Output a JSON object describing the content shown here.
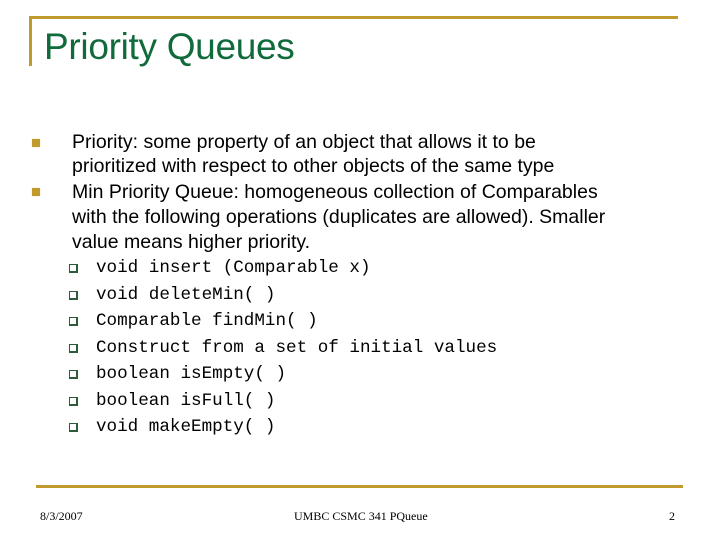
{
  "slide": {
    "title": "Priority Queues",
    "bullets": [
      {
        "lines": [
          "Priority: some property of an object that allows it to be",
          "prioritized with respect to other objects of the same type"
        ]
      },
      {
        "lines": [
          "Min Priority Queue: homogeneous collection of Comparables",
          "with the following operations (duplicates are allowed). Smaller",
          "value means higher priority."
        ],
        "sub_bullets": [
          "void insert (Comparable x)",
          "void deleteMin( )",
          "Comparable findMin( )",
          "Construct from a set of initial values",
          "boolean isEmpty( )",
          "boolean isFull( )",
          "void makeEmpty( )"
        ]
      }
    ],
    "icons": {
      "level1_bullet": "filled-square-bullet-icon",
      "level2_bullet": "hollow-square-bullet-icon"
    }
  },
  "footer": {
    "date": "8/3/2007",
    "center": "UMBC CSMC 341 PQueue",
    "page_number": "2"
  },
  "colors": {
    "title": "#106a3c",
    "accent_gold": "#c09a2c",
    "text": "#000000",
    "background": "#ffffff"
  }
}
